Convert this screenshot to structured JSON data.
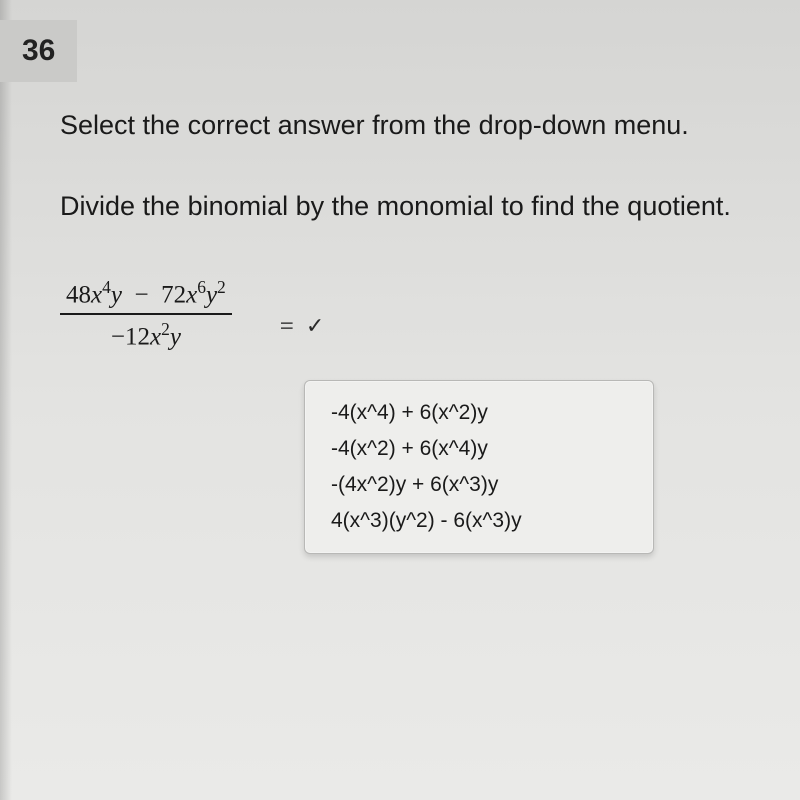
{
  "question_number": "36",
  "instruction": "Select the correct answer from the drop-down menu.",
  "prompt": "Divide the binomial by the monomial to find the quotient.",
  "fraction": {
    "numerator_html": "48<i>x</i><span class='sup'>4</span><i>y</i> &nbsp;&minus;&nbsp; 72<i>x</i><span class='sup'>6</span><i>y</i><span class='sup'>2</span>",
    "denominator_html": "&minus;12<i>x</i><span class='sup'>2</span><i>y</i>"
  },
  "equals": "=",
  "check": "✓",
  "options": [
    "-4(x^4) + 6(x^2)y",
    "-4(x^2) + 6(x^4)y",
    "-(4x^2)y + 6(x^3)y",
    "4(x^3)(y^2) - 6(x^3)y"
  ]
}
